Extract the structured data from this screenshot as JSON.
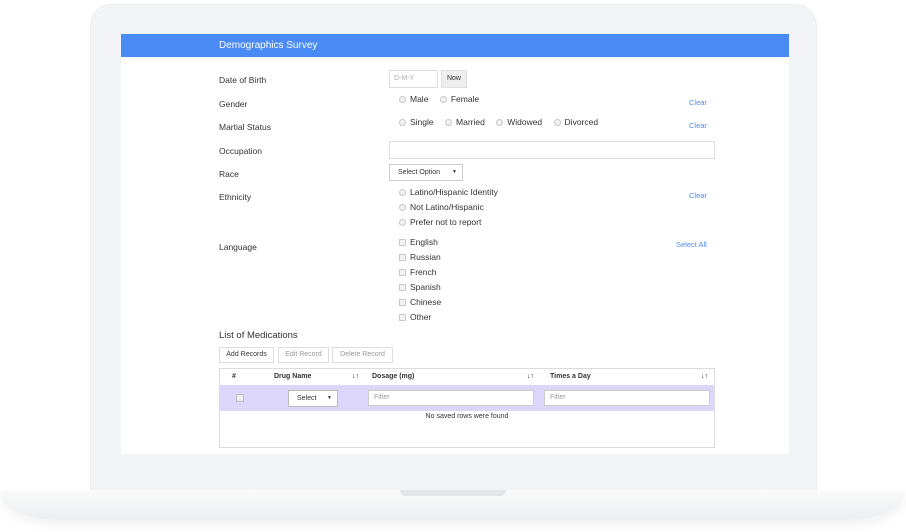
{
  "survey": {
    "title": "Demographics Survey"
  },
  "fields": {
    "dob": {
      "label": "Date of Birth",
      "placeholder": "D-M-Y",
      "now_button": "Now"
    },
    "gender": {
      "label": "Gender",
      "options": [
        "Male",
        "Female"
      ],
      "clear": "Clear"
    },
    "marital": {
      "label": "Martial Status",
      "options": [
        "Single",
        "Married",
        "Widowed",
        "Divorced"
      ],
      "clear": "Clear"
    },
    "occupation": {
      "label": "Occupation",
      "value": ""
    },
    "race": {
      "label": "Race",
      "select_value": "Select Option"
    },
    "ethnicity": {
      "label": "Ethnicity",
      "options": [
        "Latino/Hispanic Identity",
        "Not Latino/Hispanic",
        "Prefer not to report"
      ],
      "clear": "Clear"
    },
    "language": {
      "label": "Language",
      "options": [
        "English",
        "Russian",
        "French",
        "Spanish",
        "Chinese",
        "Other"
      ],
      "select_all": "Select All"
    }
  },
  "medications": {
    "title": "List of Medications",
    "toolbar": {
      "add": "Add Records",
      "edit": "Edit Record",
      "delete": "Delete Record"
    },
    "columns": [
      "#",
      "Drug Name",
      "Dosage (mg)",
      "Times a Day"
    ],
    "sort_glyph": "↓↑",
    "filters": {
      "drug_select": "Select",
      "dosage_placeholder": "Filter",
      "times_placeholder": "Filter"
    },
    "empty_message": "No saved rows were found"
  },
  "colors": {
    "header_bg": "#4a8af4",
    "link": "#4a8af4",
    "filter_row_bg": "#dcd6fa"
  }
}
